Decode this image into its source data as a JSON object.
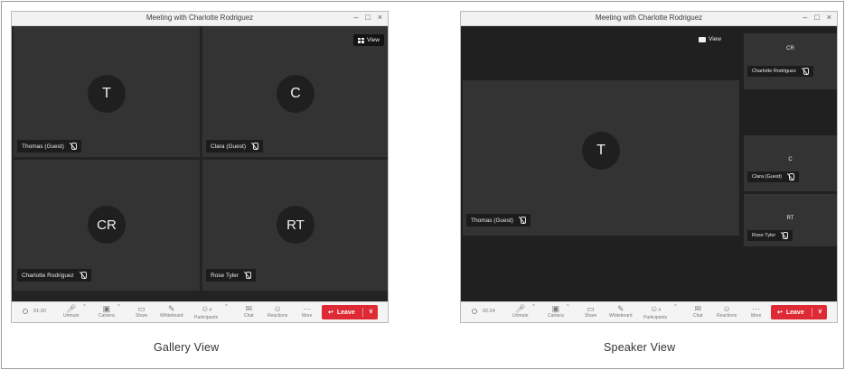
{
  "gallery": {
    "window_title": "Meeting with Charlotte Rodriguez",
    "controls": [
      "–",
      "□",
      "×"
    ],
    "view_button": "View",
    "tiles": [
      {
        "initials": "T",
        "name": "Thomas (Guest)"
      },
      {
        "initials": "C",
        "name": "Clara (Guest)"
      },
      {
        "initials": "CR",
        "name": "Charlotte Rodriguez"
      },
      {
        "initials": "RT",
        "name": "Rose Tyler"
      }
    ],
    "toolbar": {
      "timer": "01:30",
      "items": [
        "Unmute",
        "Camera",
        "Share",
        "Whiteboard",
        "Participants",
        "Chat",
        "Reactions",
        "More"
      ],
      "participants_count": "4",
      "leave": "Leave"
    },
    "caption": "Gallery View"
  },
  "speaker": {
    "window_title": "Meeting with Charlotte Rodriguez",
    "controls": [
      "–",
      "□",
      "×"
    ],
    "view_button": "View",
    "main": {
      "initials": "T",
      "name": "Thomas (Guest)"
    },
    "side_tiles": [
      {
        "initials": "CR",
        "name": "Charlotte Rodriguez"
      },
      {
        "initials": "C",
        "name": "Clara (Guest)"
      },
      {
        "initials": "RT",
        "name": "Rose Tyler"
      }
    ],
    "toolbar": {
      "timer": "02:24",
      "items": [
        "Unmute",
        "Camera",
        "Share",
        "Whiteboard",
        "Participants",
        "Chat",
        "Reactions",
        "More"
      ],
      "participants_count": "4",
      "leave": "Leave"
    },
    "caption": "Speaker View"
  },
  "icons": {
    "unmute": "mic-off-icon",
    "camera": "camera-icon",
    "share": "share-screen-icon",
    "whiteboard": "whiteboard-icon",
    "participants": "participants-icon",
    "chat": "chat-icon",
    "reactions": "reactions-icon",
    "more": "more-icon"
  },
  "colors": {
    "leave": "#de2a35",
    "tile": "#333333",
    "stage": "#232323",
    "toolbar": "#f4f4f4"
  }
}
